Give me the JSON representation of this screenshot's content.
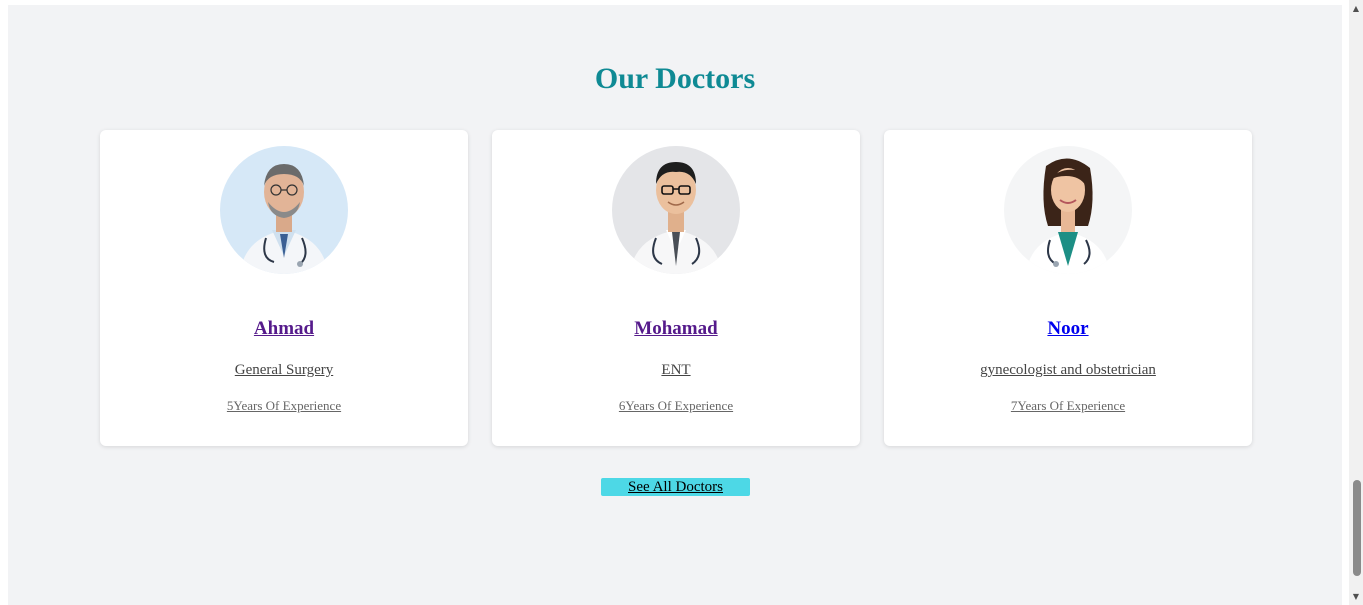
{
  "section": {
    "title": "Our Doctors"
  },
  "doctors": [
    {
      "name": "Ahmad",
      "specialty": "General Surgery",
      "experience": "5Years Of Experience",
      "photo_icon": "male-doctor-portrait"
    },
    {
      "name": "Mohamad",
      "specialty": "ENT",
      "experience": "6Years Of Experience",
      "photo_icon": "male-doctor-glasses-portrait"
    },
    {
      "name": "Noor",
      "specialty": "gynecologist and obstetrician",
      "experience": "7Years Of Experience",
      "photo_icon": "female-doctor-portrait"
    }
  ],
  "cta": {
    "see_all_label": "See All Doctors"
  },
  "colors": {
    "title": "#0f8a94",
    "background": "#f2f3f5",
    "card": "#ffffff",
    "button": "#4dd8e6",
    "visited_link": "#551a8b",
    "link": "#0000ee"
  }
}
